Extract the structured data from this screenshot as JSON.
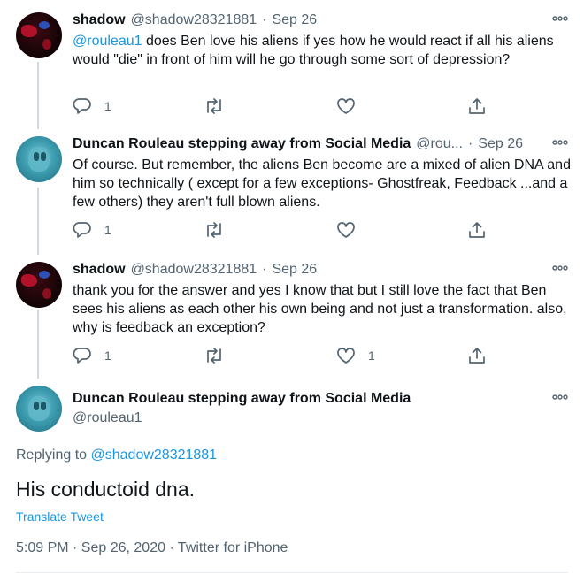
{
  "tweets": [
    {
      "name": "shadow",
      "handle": "@shadow28321881",
      "dot": "·",
      "date": "Sep 26",
      "mention": "@rouleau1",
      "text": " does Ben love his aliens if yes how he would react if all his aliens would \"die\" in front of him will he go through some sort of depression?",
      "reply_count": "1",
      "retweet_count": "",
      "like_count": "",
      "avatar_style": "dark"
    },
    {
      "name": "Duncan Rouleau stepping away from Social Media",
      "handle": "@rou...",
      "dot": "·",
      "date": "Sep 26",
      "mention": "",
      "text": "Of course. But remember, the aliens Ben become are a mixed of alien DNA and him so technically ( except for a few exceptions- Ghostfreak, Feedback ...and a few others) they aren't full blown aliens.",
      "reply_count": "1",
      "retweet_count": "",
      "like_count": "",
      "avatar_style": "teal"
    },
    {
      "name": "shadow",
      "handle": "@shadow28321881",
      "dot": "·",
      "date": "Sep 26",
      "mention": "",
      "text": "thank you for the answer and yes I know that but I still love the fact that Ben sees his aliens as each other his own being and not just a transformation. also, why is feedback an exception?",
      "reply_count": "1",
      "retweet_count": "",
      "like_count": "1",
      "avatar_style": "dark"
    }
  ],
  "focus": {
    "name": "Duncan Rouleau stepping away from Social Media",
    "handle": "@rouleau1",
    "replying_prefix": "Replying to ",
    "replying_to": "@shadow28321881",
    "text": "His conductoid dna.",
    "translate_label": "Translate Tweet",
    "meta": "5:09 PM · Sep 26, 2020 · Twitter for iPhone"
  },
  "icons": {
    "reply": "reply-icon",
    "retweet": "retweet-icon",
    "like": "heart-icon",
    "share": "share-icon",
    "more": "more-options-icon"
  },
  "colors": {
    "accent": "#1b95e0",
    "secondary_text": "#536471",
    "thread_line": "#cfd9de"
  }
}
